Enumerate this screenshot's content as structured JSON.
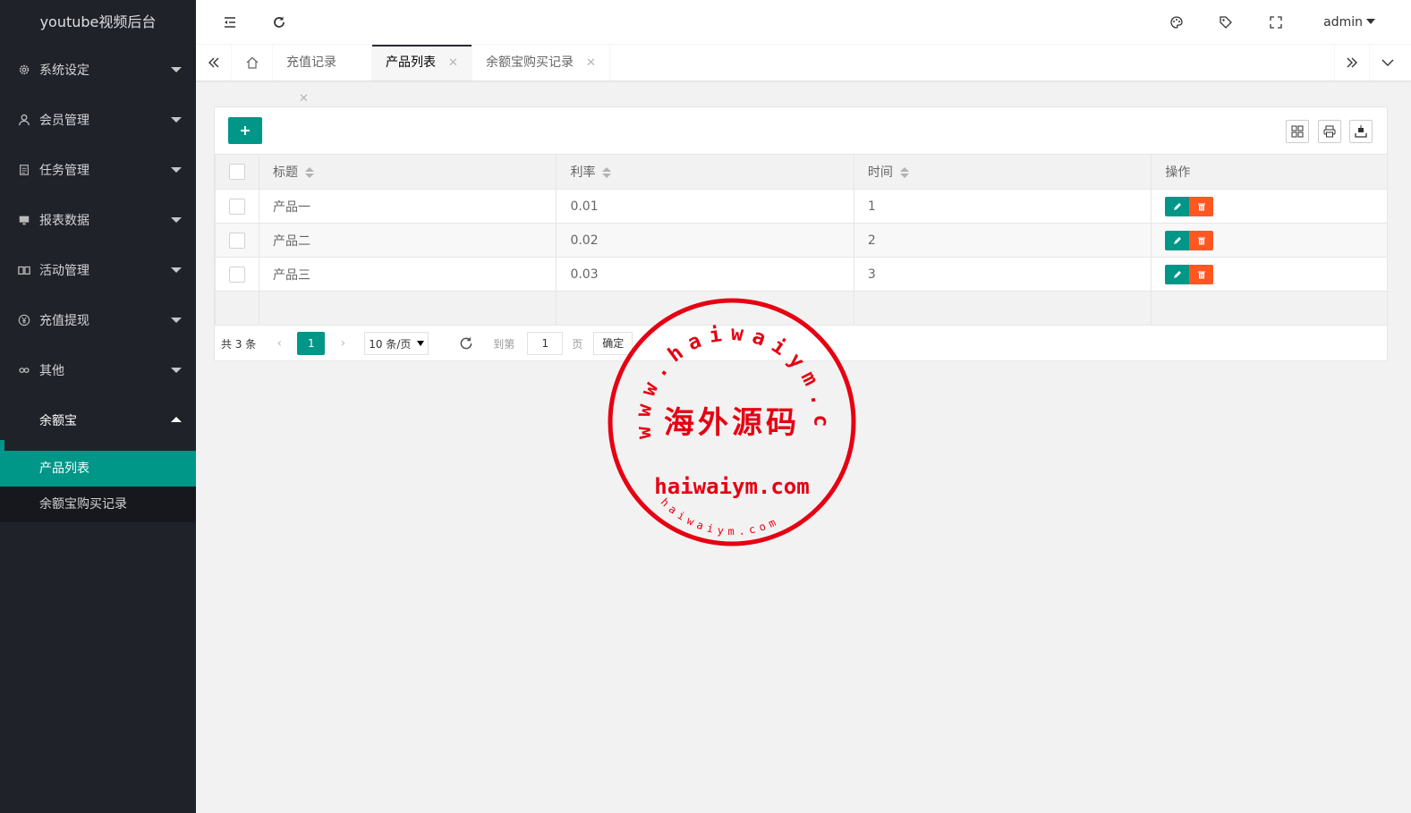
{
  "app": {
    "title": "youtube视频后台"
  },
  "sidebar": {
    "items": [
      {
        "label": "系统设定",
        "icon": "gear-icon"
      },
      {
        "label": "会员管理",
        "icon": "user-icon"
      },
      {
        "label": "任务管理",
        "icon": "list-icon"
      },
      {
        "label": "报表数据",
        "icon": "monitor-icon"
      },
      {
        "label": "活动管理",
        "icon": "read-icon"
      },
      {
        "label": "充值提现",
        "icon": "rmb-icon"
      },
      {
        "label": "其他",
        "icon": "link-icon"
      },
      {
        "label": "余额宝",
        "icon": ""
      }
    ],
    "subitems": [
      {
        "label": "产品列表",
        "active": true
      },
      {
        "label": "余额宝购买记录",
        "active": false
      }
    ]
  },
  "header": {
    "user": "admin"
  },
  "tabs": [
    {
      "label": "充值记录",
      "close": "✕"
    },
    {
      "label": "产品列表",
      "close": "✕"
    },
    {
      "label": "余额宝购买记录",
      "close": "✕"
    }
  ],
  "table": {
    "columns": [
      "标题",
      "利率",
      "时间",
      "操作"
    ],
    "rows": [
      {
        "title": "产品一",
        "rate": "0.01",
        "time": "1"
      },
      {
        "title": "产品二",
        "rate": "0.02",
        "time": "2"
      },
      {
        "title": "产品三",
        "rate": "0.03",
        "time": "3"
      }
    ]
  },
  "pager": {
    "total": "共 3 条",
    "current": "1",
    "per_page": "10 条/页",
    "goto_label": "到第",
    "goto_value": "1",
    "page_label": "页",
    "confirm": "确定"
  },
  "watermark": {
    "ring_text": "www.haiwaiym.com",
    "center_cn": "海外源码",
    "center_en": "haiwaiym.com",
    "bottom_small": "haiwaiym.com"
  },
  "colors": {
    "sidebar_bg": "#20222a",
    "accent": "#009688",
    "danger": "#ff5722",
    "stamp_red": "#e60012"
  }
}
